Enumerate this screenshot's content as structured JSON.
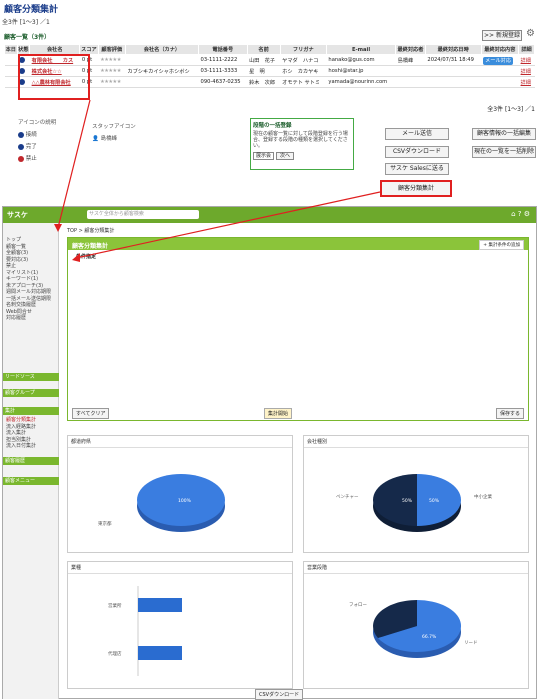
{
  "page_title": "顧客分類集計",
  "top_count": "全3件 [1～3] ／1",
  "new_button": ">> 新規登録",
  "section1": "顧客一覧（3件）",
  "table": {
    "headers": [
      "本日",
      "状態",
      "会社名",
      "スコア",
      "顧客評価",
      "会社名（カナ）",
      "電話番号",
      "名前",
      "フリガナ",
      "E-mail",
      "最終対応者",
      "最終対応日時",
      "最終対応内容",
      "詳細"
    ],
    "rows": [
      {
        "company": "有限会社　　カス",
        "score": "0 pt",
        "kana": "",
        "phone": "03-1111-2222",
        "name": "山田　花子",
        "furigana": "ヤマダ　ハナコ",
        "email": "hanako@gus.com",
        "staff": "島橋峰",
        "date": "2024/07/31 18:49",
        "content": "メール対応",
        "edit": "詳細"
      },
      {
        "company": "株式会社☆☆",
        "score": "0 pt",
        "kana": "カブシキカイシャホシボシ",
        "phone": "03-1111-3333",
        "name": "星　明",
        "furigana": "ホシ　カカヤキ",
        "email": "hoshi@star.jp",
        "staff": "",
        "date": "",
        "content": "",
        "edit": "詳細"
      },
      {
        "company": "△△農林有限会社",
        "score": "0 pt",
        "kana": "",
        "phone": "090-4637-0235",
        "name": "鈴木　次郎",
        "furigana": "オモテト サトミ",
        "email": "yamada@nourinn.com",
        "staff": "",
        "date": "",
        "content": "",
        "edit": "詳細"
      }
    ]
  },
  "count2": "全3件 [1～3] ／1",
  "legend": {
    "title": "アイコンの説明",
    "staff_title": "スタッフアイコン",
    "items": [
      "接続",
      "完了",
      "禁止"
    ],
    "staff": "島橋峰"
  },
  "bulk": {
    "title": "段階の一括登録",
    "text": "現在の顧客一覧に対して段階登録を行う場合、登録する段階の種類を選択してください。",
    "select": "展示会",
    "button": "次へ"
  },
  "buttons": {
    "mail": "メール送信",
    "csv": "CSVダウンロード",
    "sales": "サスケ Salesに送る",
    "aggregate": "顧客分類集計",
    "bulk_edit": "顧客情報の一括編集",
    "bulk_delete": "現在の一覧を一括削除"
  },
  "shot": {
    "logo": "サスケ",
    "search_placeholder": "サスケ全体から顧客検索",
    "breadcrumb": "TOP > 顧客分類集計",
    "panel_title": "顧客分類集計",
    "add_condition": "+ 集計条件の追加",
    "condition_label": "条件指定",
    "side_items": [
      "トップ",
      "顧客一覧",
      "全顧客(3)",
      "要対応(3)",
      "禁止",
      "マイリスト(1)",
      "キーワード(1)",
      "未アプローチ(3)",
      "週間メール対応期限",
      "一括メール送信期限",
      "名刺交換履歴",
      "Web問合せ",
      "対応履歴"
    ],
    "side_heads": [
      "リードソース",
      "顧客グループ",
      "集計",
      "顧客履歴",
      "顧客メニュー"
    ],
    "agg_items": [
      "顧客分類集計",
      "流入経路集計",
      "流入集計",
      "担当別集計",
      "流入日付集計"
    ],
    "csv_bottom": "CSVダウンロード",
    "clear": "すべてクリア",
    "run": "集計開始",
    "save": "保存する",
    "charts": [
      {
        "title": "都道府県",
        "pie_label": "東京都",
        "value": "100%"
      },
      {
        "title": "会社種別",
        "pie_label": "ベンチャー",
        "value": "50%",
        "other": "中小企業"
      },
      {
        "title": "業種",
        "bar1": "営業所",
        "bar2": "代理店"
      },
      {
        "title": "営業段階",
        "pie_label": "リード",
        "value": "66.7%",
        "other": "フォロー"
      }
    ]
  }
}
